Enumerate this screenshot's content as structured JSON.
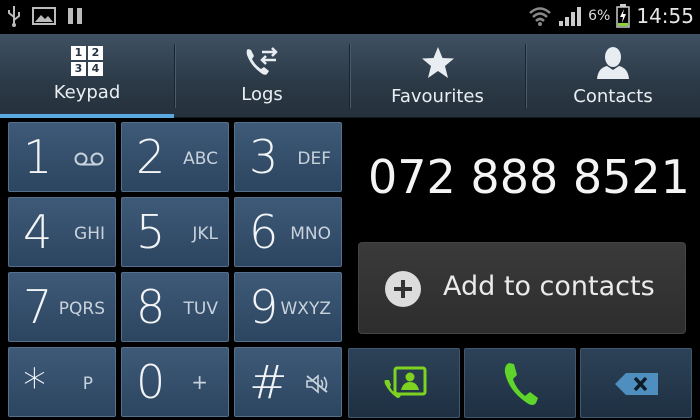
{
  "status_bar": {
    "battery_percent": "6%",
    "time": "14:55",
    "icons": [
      "usb-icon",
      "image-icon",
      "pause-icon",
      "wifi-icon",
      "signal-icon",
      "battery-charging-icon"
    ]
  },
  "tabs": [
    {
      "label": "Keypad",
      "icon": "keypad-grid-icon",
      "active": true
    },
    {
      "label": "Logs",
      "icon": "call-logs-icon",
      "active": false
    },
    {
      "label": "Favourites",
      "icon": "star-icon",
      "active": false
    },
    {
      "label": "Contacts",
      "icon": "person-icon",
      "active": false
    }
  ],
  "keypad_icon_digits": [
    "1",
    "2",
    "3",
    "4"
  ],
  "keys": [
    {
      "digit": "1",
      "letters": "",
      "icon": "voicemail-icon"
    },
    {
      "digit": "2",
      "letters": "ABC"
    },
    {
      "digit": "3",
      "letters": "DEF"
    },
    {
      "digit": "4",
      "letters": "GHI"
    },
    {
      "digit": "5",
      "letters": "JKL"
    },
    {
      "digit": "6",
      "letters": "MNO"
    },
    {
      "digit": "7",
      "letters": "PQRS"
    },
    {
      "digit": "8",
      "letters": "TUV"
    },
    {
      "digit": "9",
      "letters": "WXYZ"
    },
    {
      "digit": "*",
      "letters": "P"
    },
    {
      "digit": "0",
      "letters": "+"
    },
    {
      "digit": "#",
      "letters": "",
      "icon": "mute-icon"
    }
  ],
  "dialed_number": "072 888 8521",
  "add_contact": {
    "label": "Add to contacts"
  },
  "actions": [
    {
      "name": "video-call-button",
      "icon": "contact-card-icon",
      "color": "#7ed321"
    },
    {
      "name": "call-button",
      "icon": "phone-icon",
      "color": "#5fd42a"
    },
    {
      "name": "backspace-button",
      "icon": "backspace-icon",
      "color": "#4f8fc0"
    }
  ],
  "colors": {
    "accent": "#5aa8e0",
    "call_green": "#5fd42a"
  }
}
